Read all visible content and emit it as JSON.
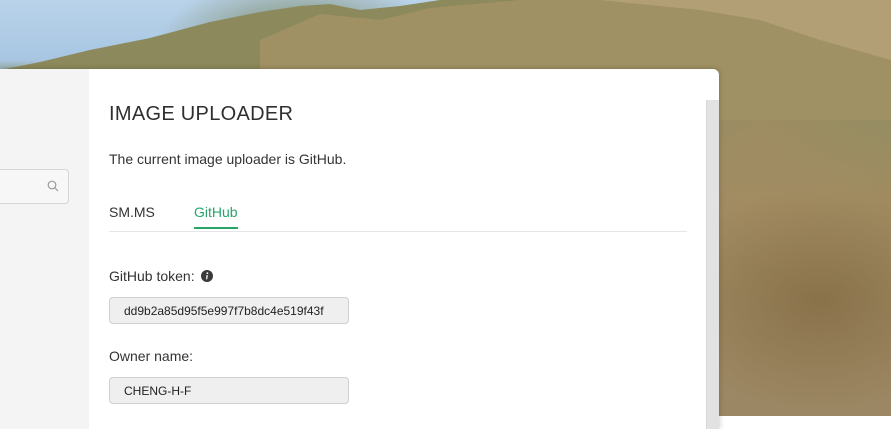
{
  "section": {
    "title": "IMAGE UPLOADER",
    "current_uploader_text": "The current image uploader is GitHub."
  },
  "tabs": [
    {
      "label": "SM.MS",
      "active": false
    },
    {
      "label": "GitHub",
      "active": true
    }
  ],
  "form": {
    "token_label": "GitHub token:",
    "token_value": "dd9b2a85d95f5e997f7b8dc4e519f43f",
    "owner_label": "Owner name:",
    "owner_value": "CHENG-H-F"
  },
  "sidebar": {
    "search_icon": "search-icon"
  },
  "colors": {
    "accent": "#26a66b",
    "text": "#333333",
    "input_bg": "#efefef"
  }
}
